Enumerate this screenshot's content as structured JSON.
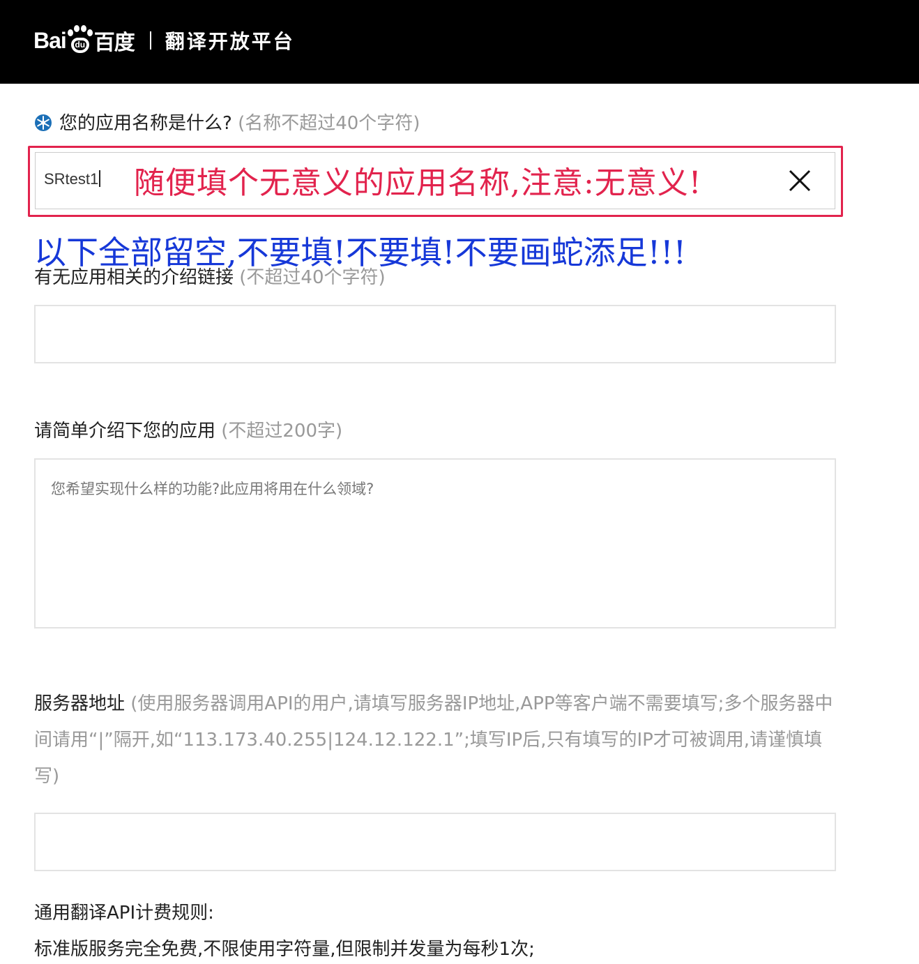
{
  "header": {
    "logo_latin": "Bai",
    "logo_paw_text": "du",
    "logo_chinese": "百度",
    "platform_name": "翻译开放平台",
    "background": "#000000"
  },
  "form": {
    "app_name": {
      "label": "您的应用名称是什么?",
      "hint": "(名称不超过40个字符)",
      "value": "SRtest1",
      "required_icon": "snowflake-icon"
    },
    "intro_link": {
      "label": "有无应用相关的介绍链接",
      "hint": "(不超过40个字符)",
      "value": ""
    },
    "description": {
      "label": "请简单介绍下您的应用",
      "hint": "(不超过200字)",
      "placeholder": "您希望实现什么样的功能?此应用将用在什么领域?"
    },
    "server_address": {
      "label": "服务器地址",
      "hint": "(使用服务器调用API的用户,请填写服务器IP地址,APP等客户端不需要填写;多个服务器中间请用“|”隔开,如“113.173.40.255|124.12.122.1”;填写IP后,只有填写的IP才可被调用,请谨慎填写)",
      "value": ""
    }
  },
  "pricing": {
    "title": "通用翻译API计费规则:",
    "standard": "标准版服务完全免费,不限使用字符量,但限制并发量为每秒1次;"
  },
  "annotations": {
    "red_note": "随便填个无意义的应用名称,注意:无意义!",
    "blue_note": "以下全部留空,不要填!不要填!不要画蛇添足!!!",
    "red_color": "#e2234d",
    "blue_color": "#1638d8",
    "close_icon": "close-icon"
  }
}
